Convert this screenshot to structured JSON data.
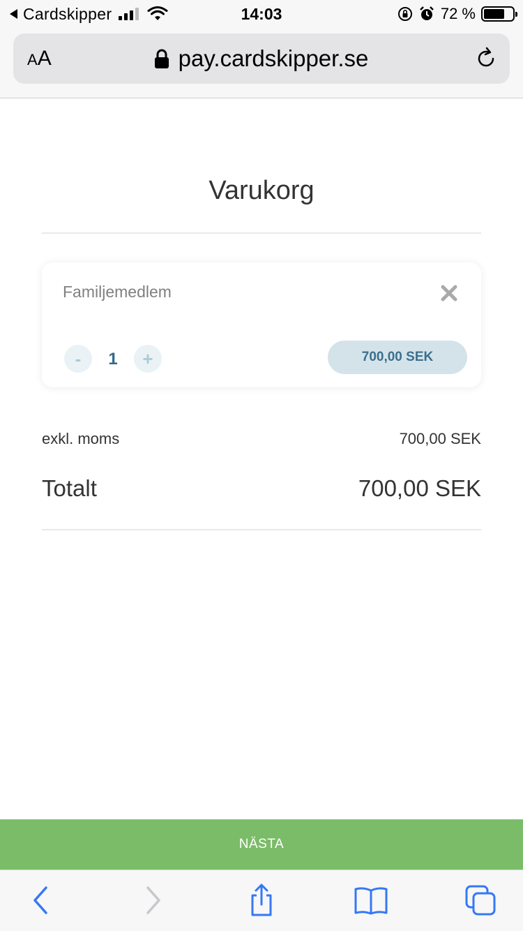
{
  "status_bar": {
    "back_app": "Cardskipper",
    "time": "14:03",
    "battery_percent": "72 %",
    "battery_level": 0.72,
    "signal_bars_filled": 3,
    "signal_bars_total": 4
  },
  "browser": {
    "text_size_small": "A",
    "text_size_large": "A",
    "url": "pay.cardskipper.se"
  },
  "page": {
    "title": "Varukorg"
  },
  "cart": {
    "items": [
      {
        "name": "Familjemedlem",
        "quantity": "1",
        "minus_label": "-",
        "plus_label": "+",
        "price": "700,00 SEK"
      }
    ]
  },
  "summary": {
    "exkl_label": "exkl. moms",
    "exkl_value": "700,00 SEK",
    "total_label": "Totalt",
    "total_value": "700,00 SEK"
  },
  "actions": {
    "next_label": "NÄSTA"
  },
  "colors": {
    "next_button": "#7bbc68",
    "price_pill": "#d4e3ea",
    "quantity_text": "#336a88",
    "toolbar_icon_active": "#3478f6",
    "toolbar_icon_disabled": "#c7c7cc"
  },
  "icons": {
    "remove": "close-icon",
    "lock": "lock-icon",
    "reload": "reload-icon",
    "back": "chevron-left-icon",
    "forward": "chevron-right-icon",
    "share": "share-icon",
    "bookmarks": "book-icon",
    "tabs": "tabs-icon"
  }
}
